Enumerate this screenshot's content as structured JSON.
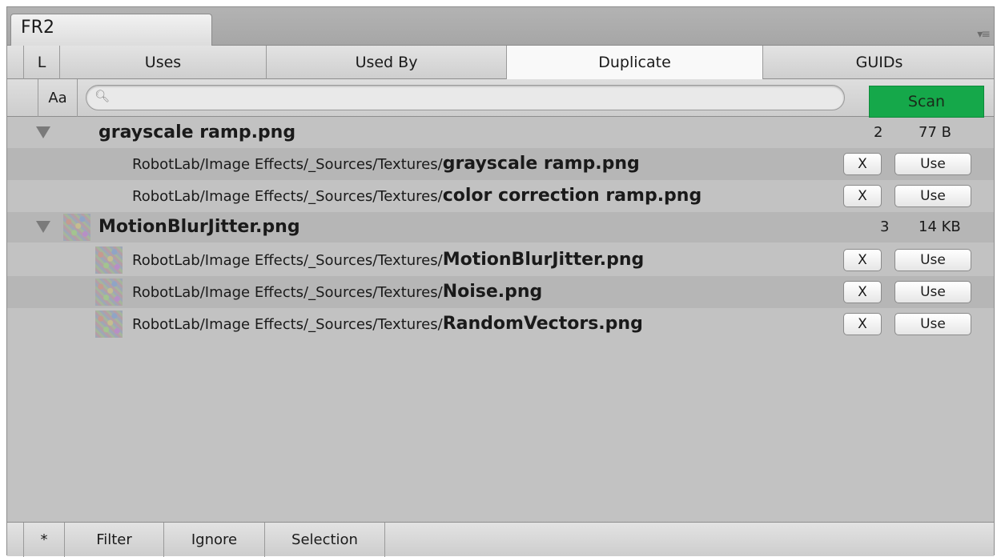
{
  "window": {
    "tab_title": "FR2"
  },
  "mode_tabs": {
    "lock": "L",
    "uses": "Uses",
    "used_by": "Used By",
    "duplicate": "Duplicate",
    "guids": "GUIDs"
  },
  "search": {
    "case_toggle": "Aa",
    "value": "",
    "placeholder": "",
    "scan_label": "Scan",
    "scan_color": "#15a84a"
  },
  "groups": [
    {
      "name": "grayscale ramp.png",
      "count": "2",
      "size": "77 B",
      "items": [
        {
          "path": "RobotLab/Image Effects/_Sources/Textures/",
          "file": "grayscale ramp.png",
          "x_label": "X",
          "use_label": "Use"
        },
        {
          "path": "RobotLab/Image Effects/_Sources/Textures/",
          "file": "color correction ramp.png",
          "x_label": "X",
          "use_label": "Use"
        }
      ]
    },
    {
      "name": "MotionBlurJitter.png",
      "count": "3",
      "size": "14 KB",
      "items": [
        {
          "path": "RobotLab/Image Effects/_Sources/Textures/",
          "file": "MotionBlurJitter.png",
          "x_label": "X",
          "use_label": "Use"
        },
        {
          "path": "RobotLab/Image Effects/_Sources/Textures/",
          "file": "Noise.png",
          "x_label": "X",
          "use_label": "Use"
        },
        {
          "path": "RobotLab/Image Effects/_Sources/Textures/",
          "file": "RandomVectors.png",
          "x_label": "X",
          "use_label": "Use"
        }
      ]
    }
  ],
  "bottom_bar": {
    "star": "*",
    "filter": "Filter",
    "ignore": "Ignore",
    "selection": "Selection"
  }
}
